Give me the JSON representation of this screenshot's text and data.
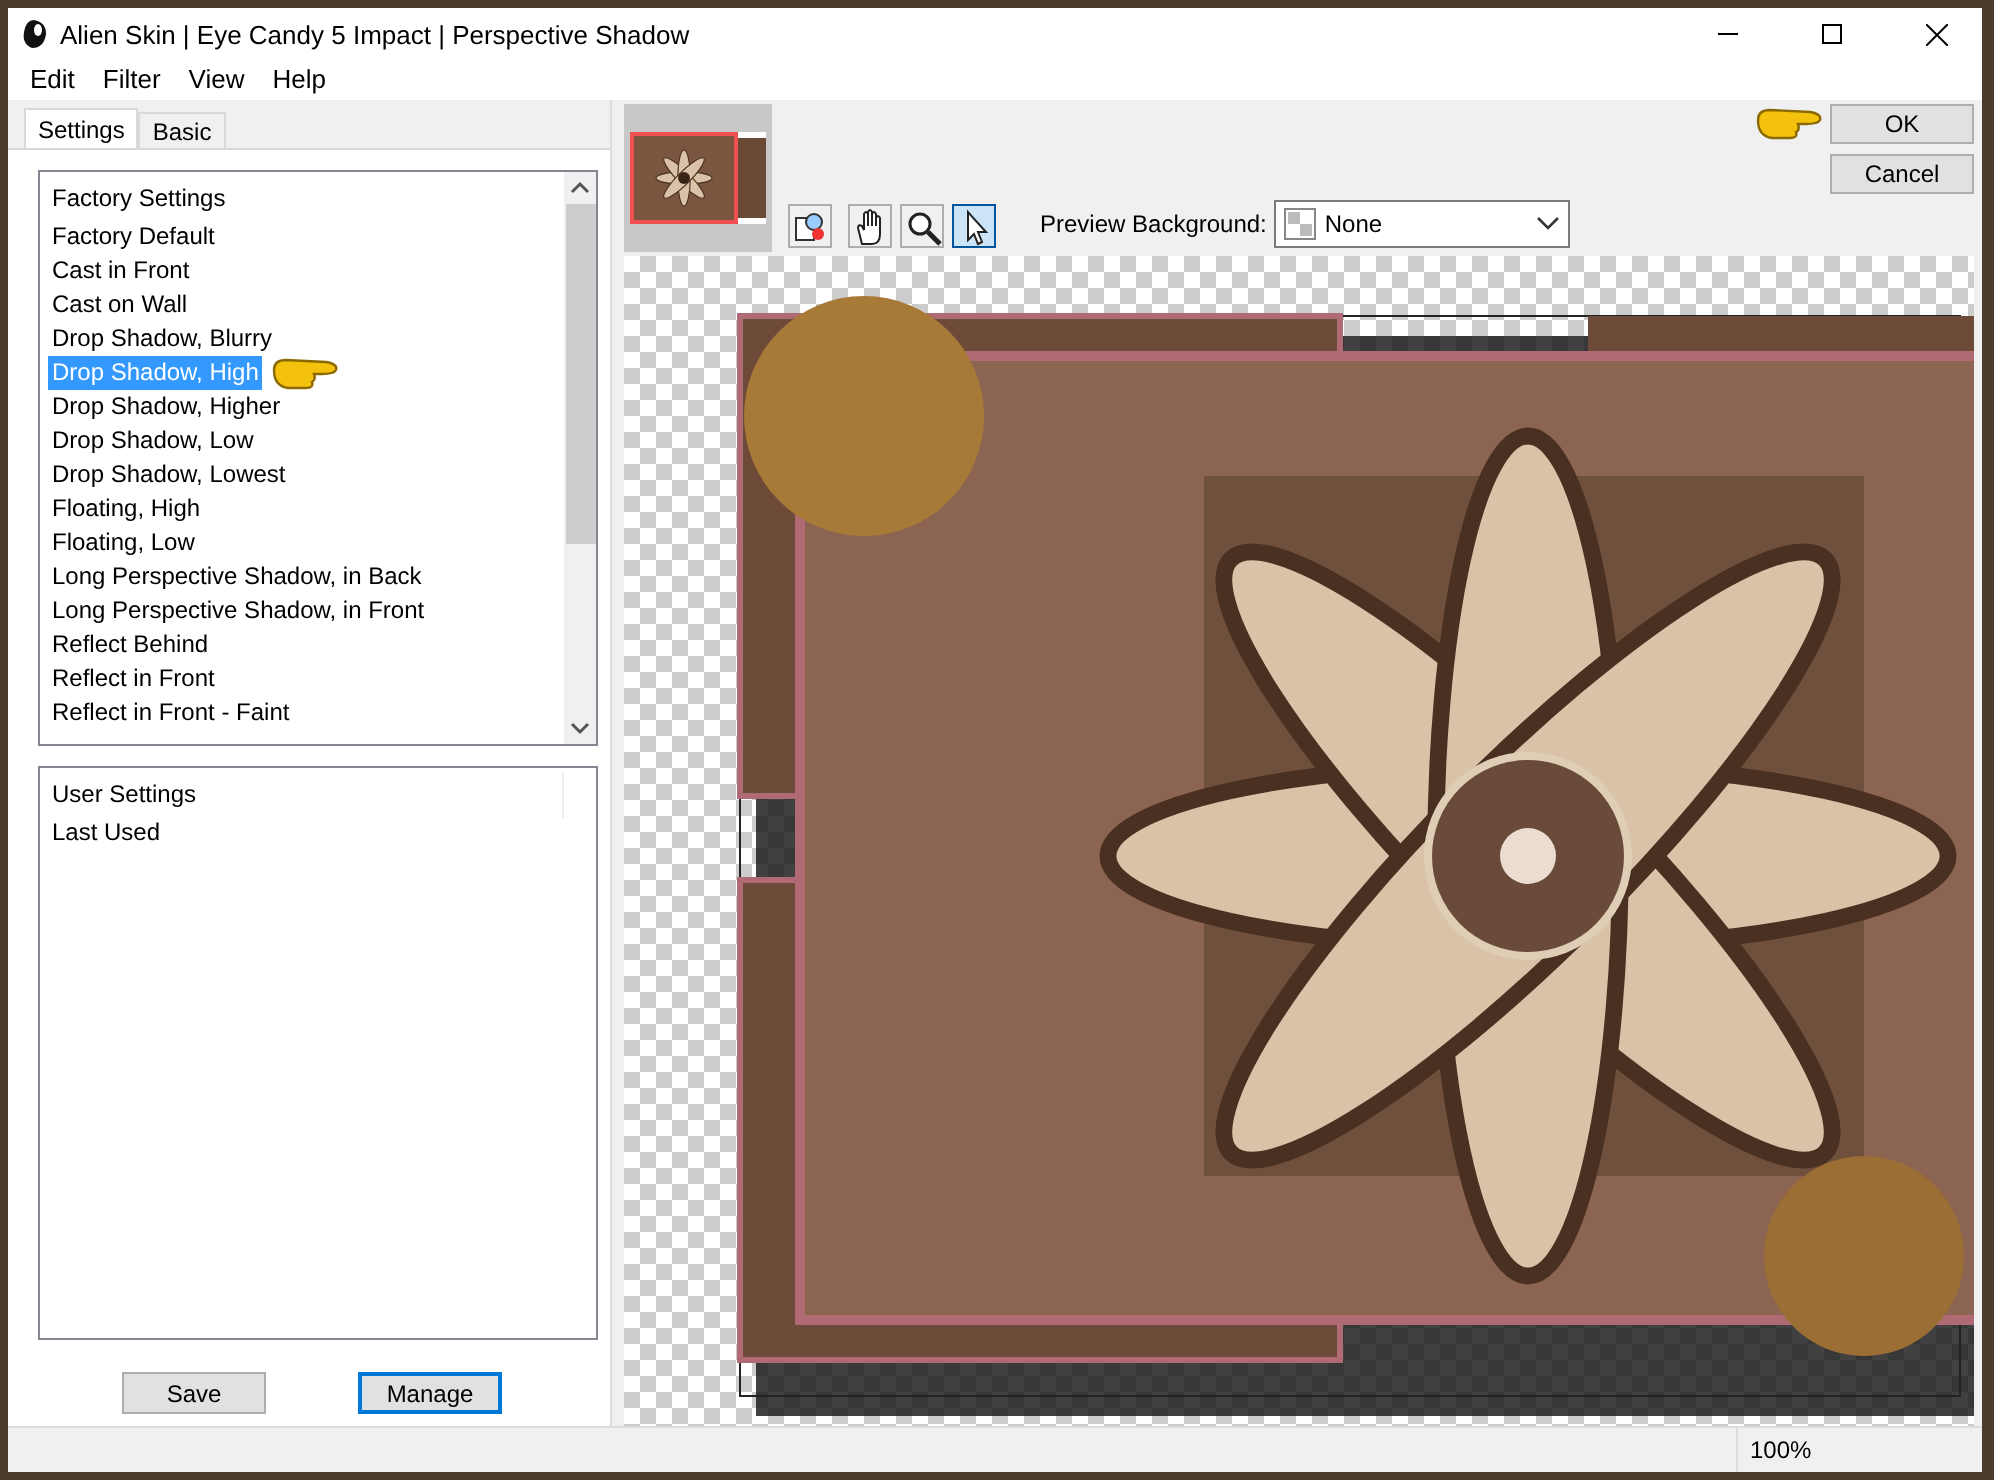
{
  "window": {
    "title": "Alien Skin | Eye Candy 5 Impact | Perspective Shadow"
  },
  "menu": [
    "Edit",
    "Filter",
    "View",
    "Help"
  ],
  "tabs": [
    {
      "label": "Settings",
      "selected": true
    },
    {
      "label": "Basic",
      "selected": false
    }
  ],
  "factory_settings": {
    "header": "Factory Settings",
    "items": [
      {
        "label": "Factory Default",
        "selected": false
      },
      {
        "label": "Cast in Front",
        "selected": false
      },
      {
        "label": "Cast on Wall",
        "selected": false
      },
      {
        "label": "Drop Shadow, Blurry",
        "selected": false
      },
      {
        "label": "Drop Shadow, High",
        "selected": true
      },
      {
        "label": "Drop Shadow, Higher",
        "selected": false
      },
      {
        "label": "Drop Shadow, Low",
        "selected": false
      },
      {
        "label": "Drop Shadow, Lowest",
        "selected": false
      },
      {
        "label": "Floating, High",
        "selected": false
      },
      {
        "label": "Floating, Low",
        "selected": false
      },
      {
        "label": "Long Perspective Shadow, in Back",
        "selected": false
      },
      {
        "label": "Long Perspective Shadow, in Front",
        "selected": false
      },
      {
        "label": "Reflect Behind",
        "selected": false
      },
      {
        "label": "Reflect in Front",
        "selected": false
      },
      {
        "label": "Reflect in Front - Faint",
        "selected": false
      }
    ]
  },
  "user_settings": {
    "header": "User Settings",
    "items": [
      {
        "label": "Last Used",
        "selected": false
      }
    ]
  },
  "settings_buttons": [
    {
      "label": "Save",
      "focused": false
    },
    {
      "label": "Manage",
      "focused": true
    }
  ],
  "tools": [
    {
      "kind": "preview",
      "selected": false
    },
    {
      "kind": "hand",
      "selected": false
    },
    {
      "kind": "zoom",
      "selected": false
    },
    {
      "kind": "pointer",
      "selected": true
    }
  ],
  "preview_background": {
    "label": "Preview Background:",
    "value": "None"
  },
  "dialog_buttons": [
    "OK",
    "Cancel"
  ],
  "status_bar": {
    "zoom": "100%"
  }
}
